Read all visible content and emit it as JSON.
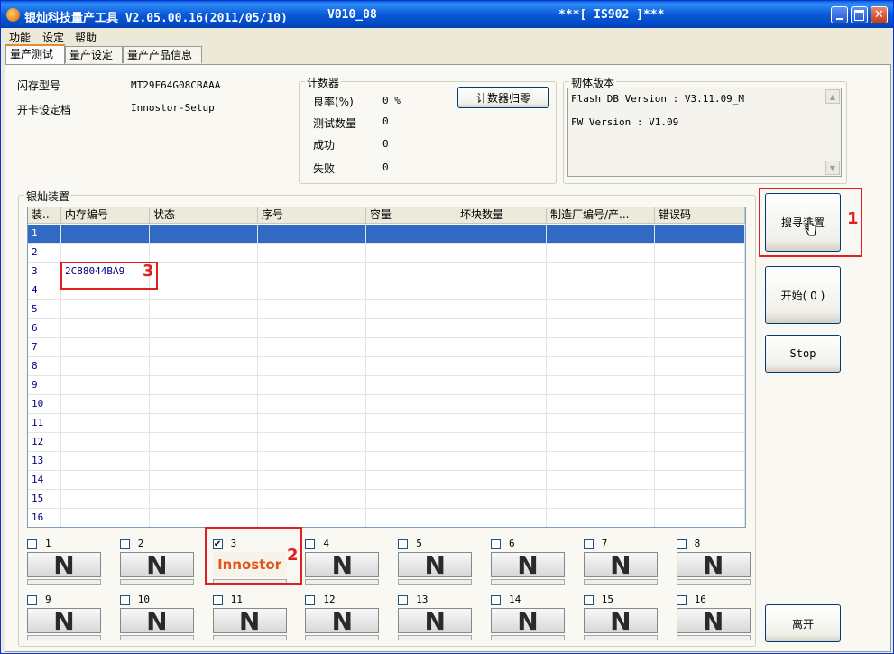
{
  "window": {
    "title": "银灿科技量产工具 V2.05.00.16(2011/05/10)",
    "version_tag": "V010_08",
    "model_tag": "***[ IS902 ]***"
  },
  "menu": [
    "功能",
    "设定",
    "帮助"
  ],
  "tabs": [
    "量产测试",
    "量产设定",
    "量产产品信息"
  ],
  "info": {
    "flash_label": "闪存型号",
    "flash_value": "MT29F64G08CBAAA",
    "setup_label": "开卡设定档",
    "setup_value": "Innostor-Setup"
  },
  "counter": {
    "title": "计数器",
    "yield_label": "良率(%)",
    "yield_value": "0 %",
    "tested_label": "测试数量",
    "tested_value": "0",
    "pass_label": "成功",
    "pass_value": "0",
    "fail_label": "失败",
    "fail_value": "0",
    "reset_button": "计数器归零"
  },
  "firmware": {
    "title": "韧体版本",
    "flash_db_line": "Flash DB Version :  V3.11.09_M",
    "fw_line": "FW Version :   V1.09"
  },
  "devices": {
    "title": "银灿装置",
    "columns": [
      "装..",
      "内存编号",
      "状态",
      "序号",
      "容量",
      "坏块数量",
      "制造厂编号/产...",
      "错误码"
    ],
    "rows": [
      {
        "no": "1",
        "id": ""
      },
      {
        "no": "2",
        "id": ""
      },
      {
        "no": "3",
        "id": "2C88044BA9"
      },
      {
        "no": "4",
        "id": ""
      },
      {
        "no": "5",
        "id": ""
      },
      {
        "no": "6",
        "id": ""
      },
      {
        "no": "7",
        "id": ""
      },
      {
        "no": "8",
        "id": ""
      },
      {
        "no": "9",
        "id": ""
      },
      {
        "no": "10",
        "id": ""
      },
      {
        "no": "11",
        "id": ""
      },
      {
        "no": "12",
        "id": ""
      },
      {
        "no": "13",
        "id": ""
      },
      {
        "no": "14",
        "id": ""
      },
      {
        "no": "15",
        "id": ""
      },
      {
        "no": "16",
        "id": ""
      }
    ],
    "selected_row": 1
  },
  "buttons": {
    "search": "搜寻装置",
    "start": "开始( 0 )",
    "stop": "Stop",
    "exit": "离开"
  },
  "slots": [
    {
      "no": "1",
      "checked": false,
      "label": "N"
    },
    {
      "no": "2",
      "checked": false,
      "label": "N"
    },
    {
      "no": "3",
      "checked": true,
      "label": "Innostor"
    },
    {
      "no": "4",
      "checked": false,
      "label": "N"
    },
    {
      "no": "5",
      "checked": false,
      "label": "N"
    },
    {
      "no": "6",
      "checked": false,
      "label": "N"
    },
    {
      "no": "7",
      "checked": false,
      "label": "N"
    },
    {
      "no": "8",
      "checked": false,
      "label": "N"
    },
    {
      "no": "9",
      "checked": false,
      "label": "N"
    },
    {
      "no": "10",
      "checked": false,
      "label": "N"
    },
    {
      "no": "11",
      "checked": false,
      "label": "N"
    },
    {
      "no": "12",
      "checked": false,
      "label": "N"
    },
    {
      "no": "13",
      "checked": false,
      "label": "N"
    },
    {
      "no": "14",
      "checked": false,
      "label": "N"
    },
    {
      "no": "15",
      "checked": false,
      "label": "N"
    },
    {
      "no": "16",
      "checked": false,
      "label": "N"
    }
  ],
  "annotations": {
    "search_marker": "1",
    "slot_marker": "2",
    "id_marker": "3",
    "color": "#e02020"
  },
  "icons": {
    "minimize": "minimize-icon",
    "maximize": "maximize-icon",
    "close": "close-icon",
    "cursor": "mouse-cursor-icon"
  }
}
